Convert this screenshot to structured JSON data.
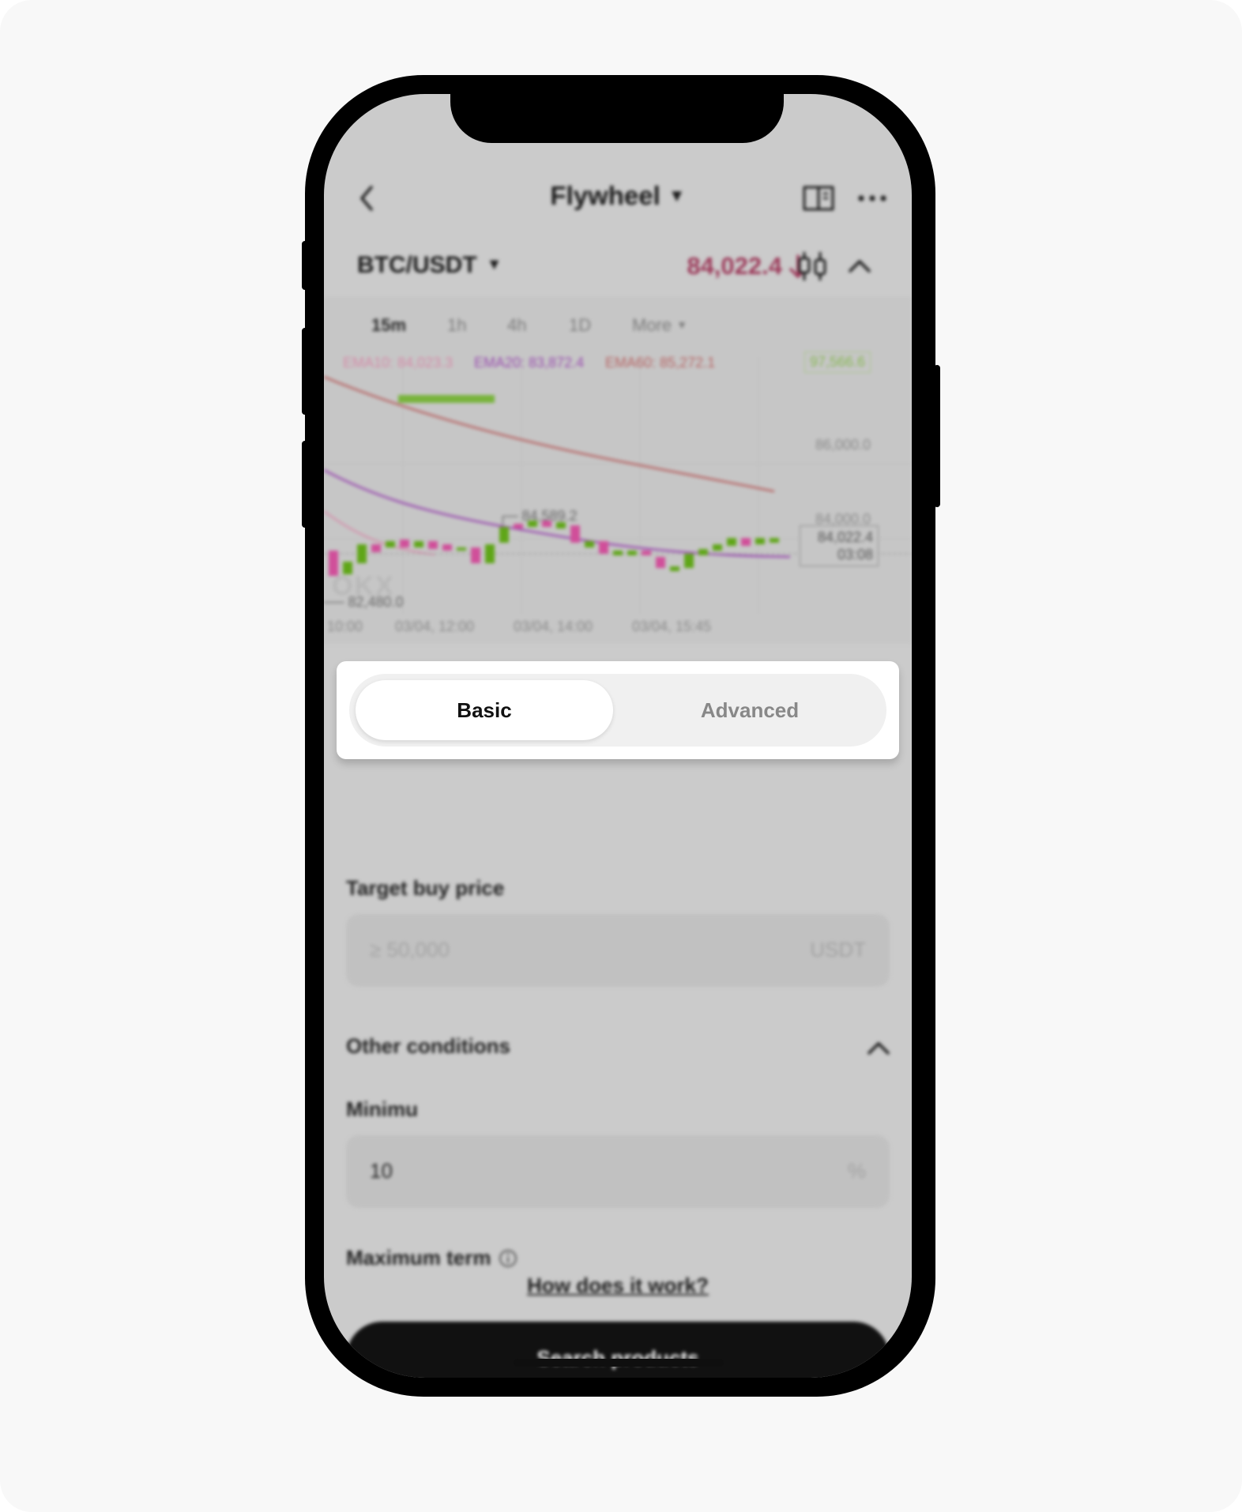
{
  "header": {
    "title": "Flywheel"
  },
  "ticker": {
    "pair": "BTC/USDT",
    "price": "84,022.4"
  },
  "timeframes": [
    {
      "label": "15m",
      "active": true
    },
    {
      "label": "1h"
    },
    {
      "label": "4h"
    },
    {
      "label": "1D"
    },
    {
      "label": "More"
    }
  ],
  "chart": {
    "ema_label_1": "EMA10: 84,023.3",
    "ema_label_2": "EMA20: 83,872.4",
    "ema_label_3": "EMA60: 85,272.1",
    "top_tag": "97,566.6",
    "gridline_1": "86,000.0",
    "gridline_2": "84,000.0",
    "current_price": "84,022.4",
    "countdown": "03:08",
    "high_mark": "84,589.2",
    "low_mark": "82,480.0",
    "x_labels": [
      "10:00",
      "03/04, 12:00",
      "03/04, 14:00",
      "03/04, 15:45"
    ]
  },
  "mode_tabs": {
    "basic": "Basic",
    "advanced": "Advanced"
  },
  "form": {
    "target_label": "Target buy price",
    "target_placeholder": "≥ 50,000",
    "target_unit": "USDT",
    "other_conditions": "Other conditions",
    "minimum_label": "Minimu",
    "minimum_value": "10",
    "minimum_unit": "%",
    "max_term_label": "Maximum term",
    "how_link": "How does it work?",
    "search_button": "Search products"
  }
}
